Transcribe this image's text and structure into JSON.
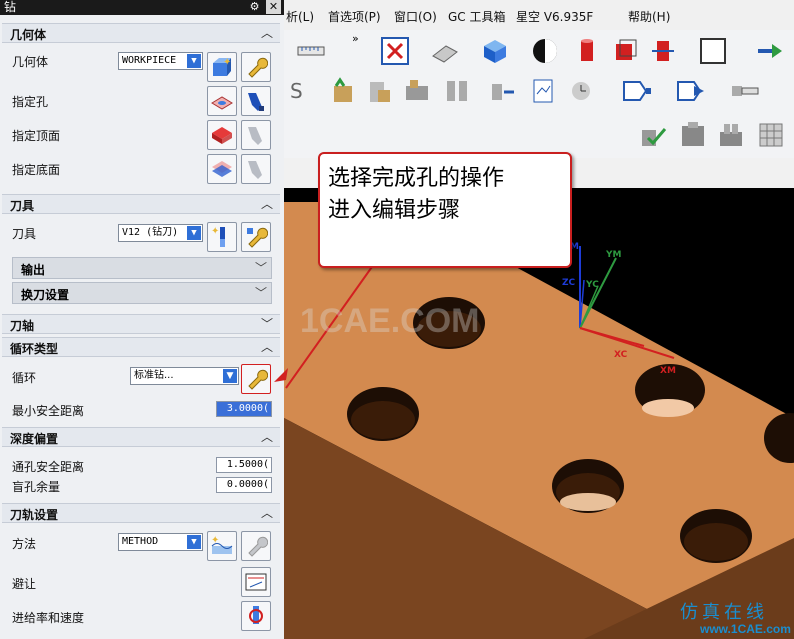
{
  "dialog": {
    "title": "钻",
    "sections": {
      "geometry": "几何体",
      "tool": "刀具",
      "axis": "刀轴",
      "cycle_type": "循环类型",
      "depth_offset": "深度偏置",
      "toolpath_settings": "刀轨设置"
    },
    "geometry": {
      "geometry_label": "几何体",
      "geometry_value": "WORKPIECE",
      "hole_label": "指定孔",
      "top_label": "指定顶面",
      "bottom_label": "指定底面"
    },
    "tool": {
      "tool_label": "刀具",
      "tool_value": "V12 (钻刀)",
      "output_label": "输出",
      "toolchange_label": "换刀设置"
    },
    "cycle": {
      "cycle_label": "循环",
      "cycle_value": "标准钻...",
      "min_clearance_label": "最小安全距离",
      "min_clearance_value": "3.0000("
    },
    "depth": {
      "through_label": "通孔安全距离",
      "through_value": "1.5000(",
      "blind_label": "盲孔余量",
      "blind_value": "0.0000("
    },
    "path": {
      "method_label": "方法",
      "method_value": "METHOD",
      "avoid_label": "避让",
      "feed_label": "进给率和速度"
    }
  },
  "menu": {
    "items": [
      "析(L)",
      "首选项(P)",
      "窗口(O)",
      "GC 工具箱",
      "星空 V6.935F",
      "帮助(H)"
    ],
    "overflow": "»"
  },
  "viewport": {
    "axis_labels": {
      "m": "M",
      "ym": "YM",
      "zc": "ZC",
      "yc": "YC",
      "xc": "XC",
      "xm": "XM"
    },
    "block_color": "#d38a4f",
    "side_color": "#9b5d2c"
  },
  "callout": {
    "line1": "选择完成孔的操作",
    "line2": "进入编辑步骤"
  },
  "watermark": "1CAE.COM",
  "footer_logo": {
    "line1": "仿真在线",
    "line2": "www.1CAE.com"
  },
  "icons": {
    "accent": "#2f6fd6",
    "wrench": "#e8b838",
    "arrow": "#d22020"
  }
}
